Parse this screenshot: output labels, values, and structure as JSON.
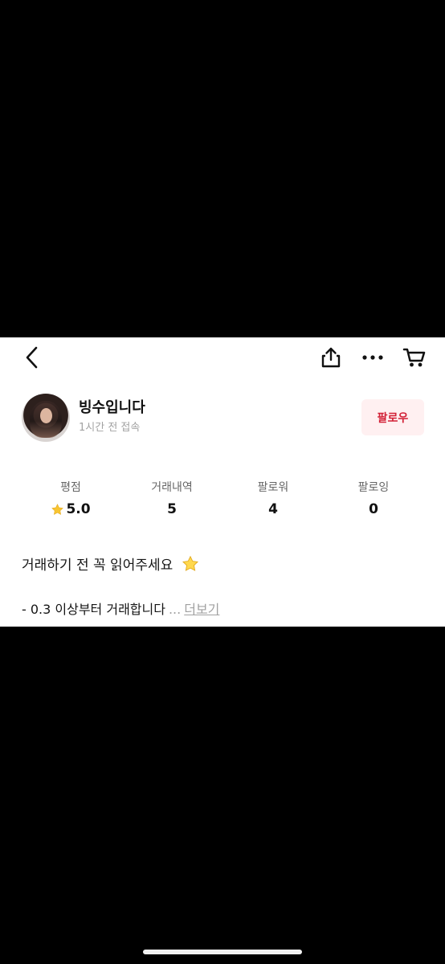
{
  "header": {
    "icons": [
      "chevron-left-icon",
      "share-icon",
      "ellipsis-icon",
      "cart-icon"
    ]
  },
  "profile": {
    "username": "빙수입니다",
    "last_seen": "1시간 전 접속",
    "follow_label": "팔로우"
  },
  "stats": [
    {
      "label": "평점",
      "value": "5.0",
      "icon": "star-icon"
    },
    {
      "label": "거래내역",
      "value": "5"
    },
    {
      "label": "팔로워",
      "value": "4"
    },
    {
      "label": "팔로잉",
      "value": "0"
    }
  ],
  "intro": {
    "title": "거래하기 전 꼭 읽어주세요",
    "title_icon": "star-emoji-icon",
    "detail": "- 0.3 이상부터 거래합니다",
    "ellipsis": "...",
    "more_label": "더보기"
  },
  "colors": {
    "accent": "#d21f35",
    "follow_background": "#fff0f1",
    "star": "#f8c531",
    "secondary_text": "#a2a2a2"
  }
}
